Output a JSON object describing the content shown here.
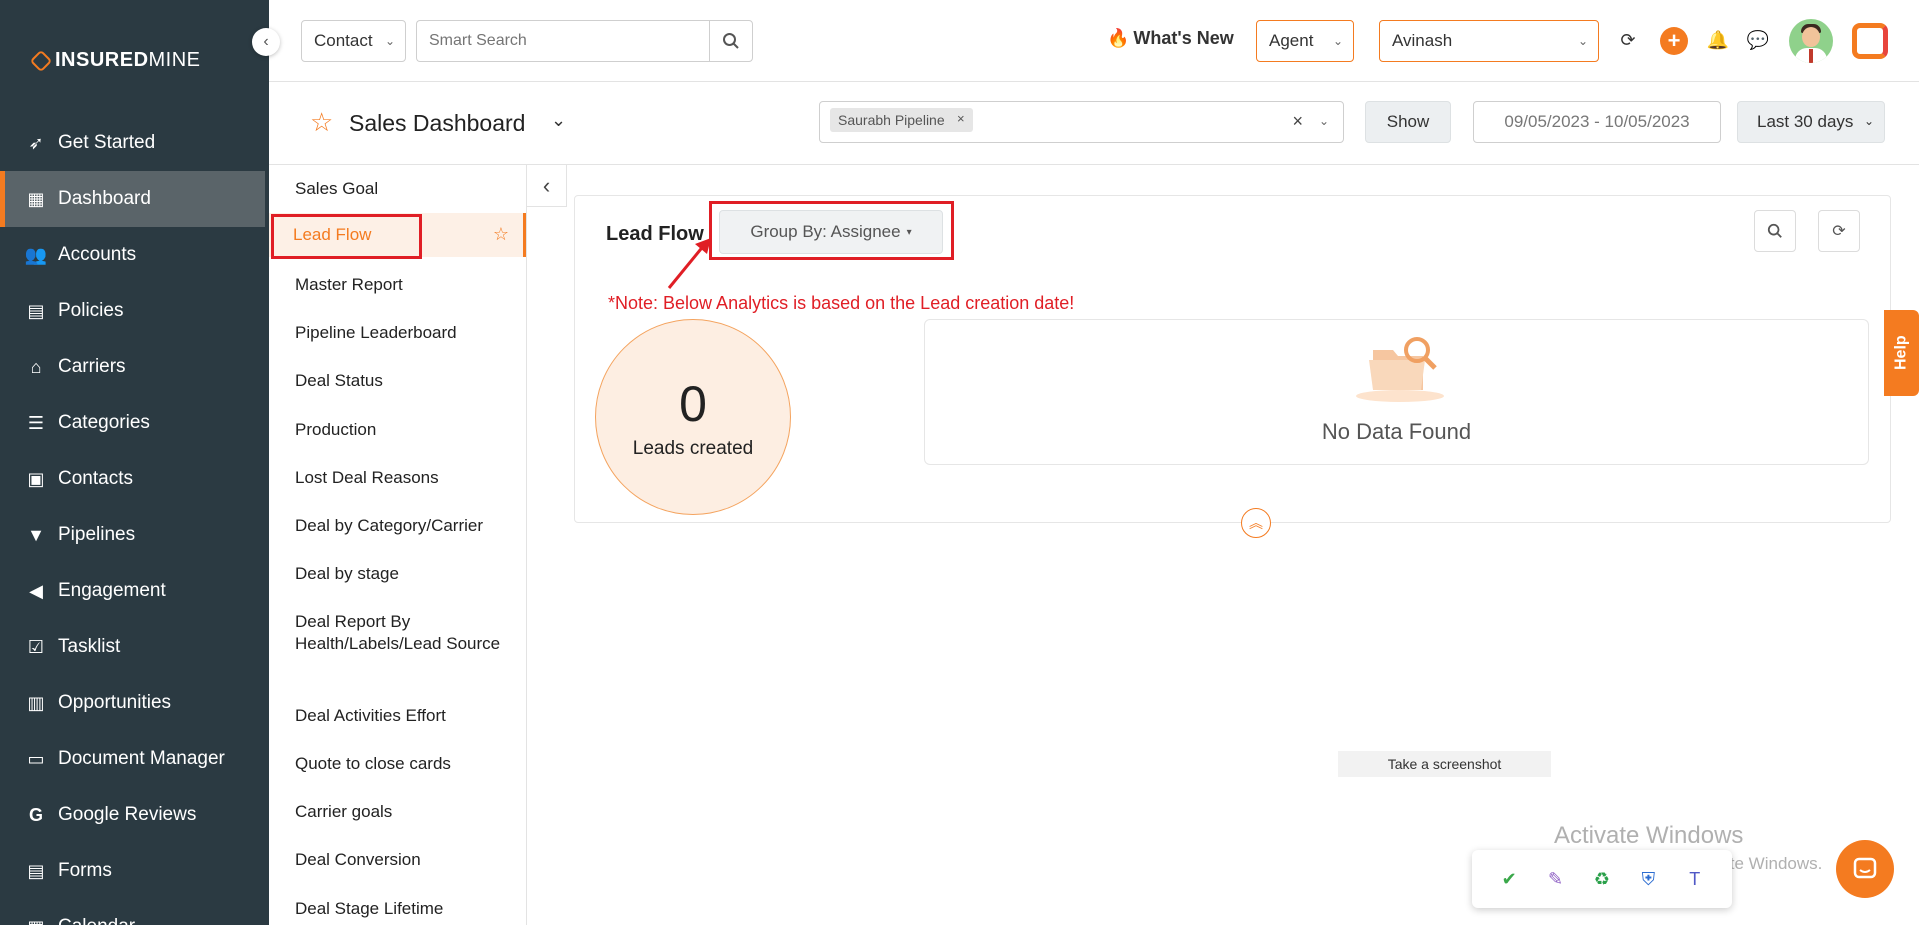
{
  "brand": {
    "name_bold": "INSURED",
    "name_rest": "MINE"
  },
  "sidebar": {
    "items": [
      {
        "label": "Get Started",
        "icon": "rocket-icon"
      },
      {
        "label": "Dashboard",
        "icon": "dashboard-icon"
      },
      {
        "label": "Accounts",
        "icon": "accounts-icon"
      },
      {
        "label": "Policies",
        "icon": "policies-icon"
      },
      {
        "label": "Carriers",
        "icon": "bank-icon"
      },
      {
        "label": "Categories",
        "icon": "list-icon"
      },
      {
        "label": "Contacts",
        "icon": "contact-card-icon"
      },
      {
        "label": "Pipelines",
        "icon": "funnel-icon"
      },
      {
        "label": "Engagement",
        "icon": "megaphone-icon"
      },
      {
        "label": "Tasklist",
        "icon": "tasklist-icon"
      },
      {
        "label": "Opportunities",
        "icon": "bar-chart-icon"
      },
      {
        "label": "Document Manager",
        "icon": "folder-icon"
      },
      {
        "label": "Google Reviews",
        "icon": "google-icon"
      },
      {
        "label": "Forms",
        "icon": "form-icon"
      },
      {
        "label": "Calendar",
        "icon": "calendar-icon"
      }
    ],
    "active": "Dashboard"
  },
  "topbar": {
    "contact_select": "Contact",
    "search_placeholder": "Smart Search",
    "whats_new": "What's New",
    "role_select": "Agent",
    "user_select": "Avinash"
  },
  "header": {
    "dashboard_title": "Sales Dashboard",
    "pipeline_chip": "Saurabh Pipeline",
    "show_button": "Show",
    "date_range": "09/05/2023 - 10/05/2023",
    "range_select": "Last 30 days"
  },
  "reports": {
    "items": [
      "Sales Goal",
      "Lead Flow",
      "Master Report",
      "Pipeline Leaderboard",
      "Deal Status",
      "Production",
      "Lost Deal Reasons",
      "Deal by Category/Carrier",
      "Deal by stage",
      "Deal Report By Health/Labels/Lead Source",
      "Deal Activities Effort",
      "Quote to close cards",
      "Carrier goals",
      "Deal Conversion",
      "Deal Stage Lifetime"
    ],
    "active": "Lead Flow"
  },
  "card": {
    "title": "Lead Flow",
    "group_by": "Group By: Assignee",
    "note": "*Note: Below Analytics is based on the Lead creation date!",
    "leads_count": "0",
    "leads_label": "Leads created",
    "no_data": "No Data Found"
  },
  "overlays": {
    "help": "Help",
    "screenshot_tip": "Take a screenshot",
    "activate_title": "Activate Windows",
    "activate_sub": "Go to Settings to activate Windows."
  },
  "colors": {
    "accent": "#f47b20",
    "sidebar_bg": "#2b3a42",
    "annotation_red": "#e01e25"
  }
}
